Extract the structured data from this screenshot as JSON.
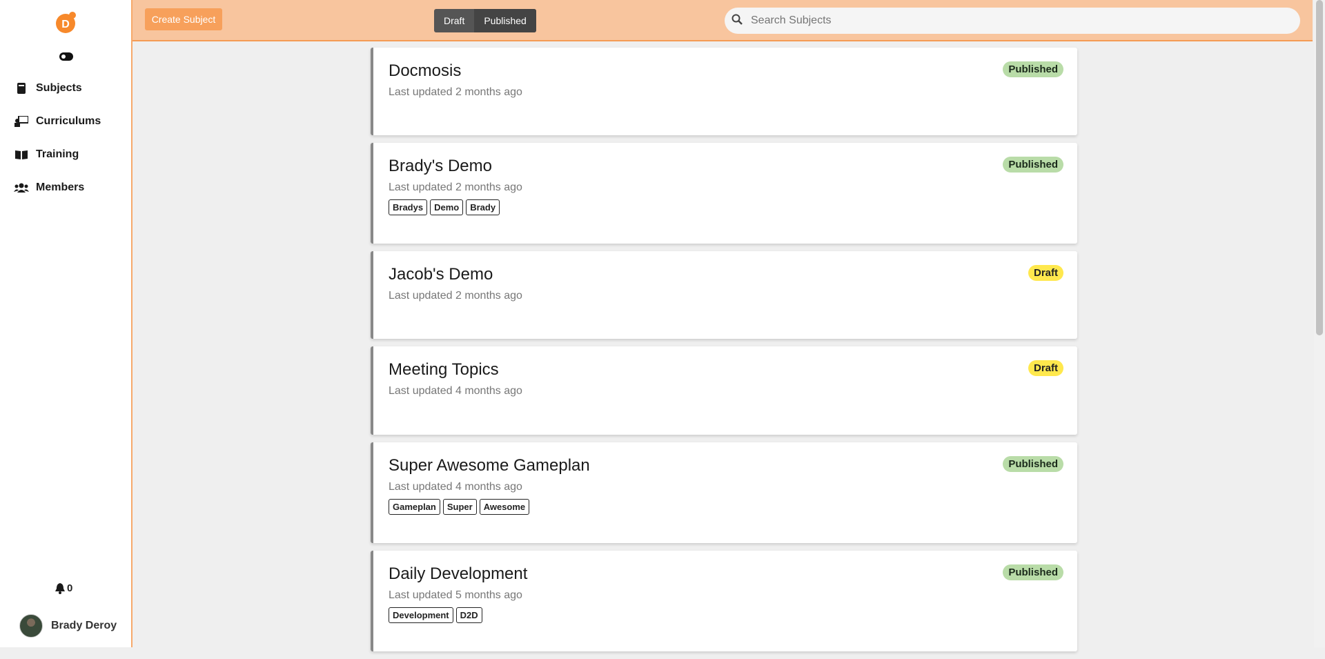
{
  "brand": {
    "logo_letter": "D",
    "accent": "#f7a05b"
  },
  "sidebar": {
    "items": [
      {
        "label": "Subjects",
        "icon": "book-icon"
      },
      {
        "label": "Curriculums",
        "icon": "teacher-board-icon"
      },
      {
        "label": "Training",
        "icon": "open-book-icon"
      },
      {
        "label": "Members",
        "icon": "users-icon"
      }
    ],
    "notification_count": "0",
    "user_name": "Brady Deroy"
  },
  "topbar": {
    "create_button": "Create Subject",
    "filter": {
      "draft": "Draft",
      "published": "Published"
    },
    "search_placeholder": "Search Subjects"
  },
  "subjects": [
    {
      "title": "Docmosis",
      "updated": "Last updated 2 months ago",
      "status": "Published",
      "tags": []
    },
    {
      "title": "Brady's Demo",
      "updated": "Last updated 2 months ago",
      "status": "Published",
      "tags": [
        "Bradys",
        "Demo",
        "Brady"
      ]
    },
    {
      "title": "Jacob's Demo",
      "updated": "Last updated 2 months ago",
      "status": "Draft",
      "tags": []
    },
    {
      "title": "Meeting Topics",
      "updated": "Last updated 4 months ago",
      "status": "Draft",
      "tags": []
    },
    {
      "title": "Super Awesome Gameplan",
      "updated": "Last updated 4 months ago",
      "status": "Published",
      "tags": [
        "Gameplan",
        "Super",
        "Awesome"
      ]
    },
    {
      "title": "Daily Development",
      "updated": "Last updated 5 months ago",
      "status": "Published",
      "tags": [
        "Development",
        "D2D"
      ]
    }
  ]
}
